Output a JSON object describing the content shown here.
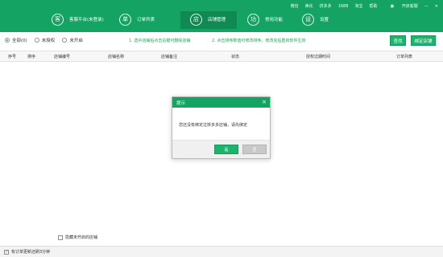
{
  "nav": {
    "items": [
      {
        "icon_char": "客",
        "label": "客服平台(未登录)"
      },
      {
        "icon_char": "单",
        "label": "订单列表"
      },
      {
        "icon_char": "店",
        "label": "店铺管理"
      },
      {
        "icon_char": "功",
        "label": "常用功能"
      },
      {
        "icon_char": "设",
        "label": "设置"
      }
    ],
    "active_index": 2
  },
  "toplinks": {
    "items": [
      "微信",
      "美化",
      "拼多多",
      "1688",
      "淘宝",
      "帮助"
    ],
    "icon_label": "开启客服",
    "minimize": "—",
    "close": "✕"
  },
  "filters": {
    "options": [
      "全部(0)",
      "未授权",
      "未开启"
    ],
    "selected_index": 0
  },
  "hints": {
    "hint1": "1. 选中店铺后点击右键可删除店铺",
    "hint2": "2. 点击排序数值可修改排序，修改完后重启软件生效"
  },
  "buttons": {
    "search": "查找",
    "bind_shop": "绑定店铺"
  },
  "table": {
    "headers": [
      "序号",
      "排序",
      "店铺编号",
      "店铺名称",
      "店铺备注",
      "状态",
      "授权过期时间",
      "订单列表"
    ]
  },
  "dialog": {
    "title": "提示",
    "close": "×",
    "message": "您还没有绑定过拼多多店铺，请先绑定",
    "ok": "是",
    "cancel": "否"
  },
  "bottom": {
    "hide_closed_label": "隐藏未开启的店铺",
    "status_checkbox_label": "有订单更新还刷3分钟"
  },
  "colors": {
    "brand": "#14a363",
    "hint": "#21a44f"
  }
}
